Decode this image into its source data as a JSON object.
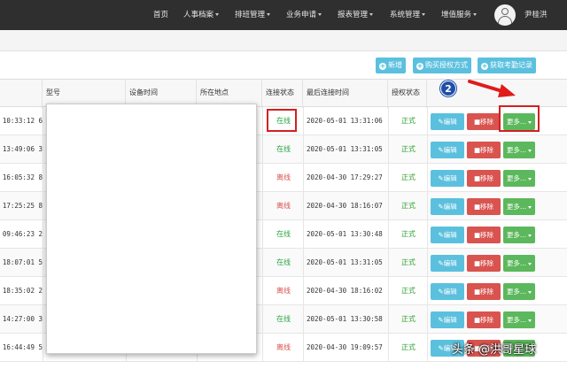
{
  "nav": {
    "items": [
      {
        "label": "首页",
        "caret": false
      },
      {
        "label": "人事档案",
        "caret": true
      },
      {
        "label": "排班管理",
        "caret": true
      },
      {
        "label": "业务申请",
        "caret": true
      },
      {
        "label": "报表管理",
        "caret": true
      },
      {
        "label": "系统管理",
        "caret": true
      },
      {
        "label": "增值服务",
        "caret": true
      }
    ],
    "user_name": "尹桂洪",
    "avatar_icon": "user-avatar-icon"
  },
  "toolbar": {
    "add_label": "新增",
    "buy_label": "购买授权方式",
    "fetch_label": "获取考勤记录",
    "button_color": "#5bc0de"
  },
  "table": {
    "headers": {
      "model": "型号",
      "device_time": "设备时间",
      "location": "所在地点",
      "status": "连接状态",
      "last_conn": "最后连接时间",
      "auth": "授权状态"
    },
    "rows": [
      {
        "time": "6 10:33:12",
        "status": "在线",
        "online": true,
        "last": "2020-05-01 13:31:06",
        "auth": "正式"
      },
      {
        "time": "3 13:49:06",
        "status": "在线",
        "online": true,
        "last": "2020-05-01 13:31:05",
        "auth": "正式"
      },
      {
        "time": "8 16:05:32",
        "status": "离线",
        "online": false,
        "last": "2020-04-30 17:29:27",
        "auth": "正式"
      },
      {
        "time": "8 17:25:25",
        "status": "离线",
        "online": false,
        "last": "2020-04-30 18:16:07",
        "auth": "正式"
      },
      {
        "time": "2 09:46:23",
        "status": "在线",
        "online": true,
        "last": "2020-05-01 13:30:48",
        "auth": "正式"
      },
      {
        "time": "5 18:07:01",
        "status": "在线",
        "online": true,
        "last": "2020-05-01 13:31:05",
        "auth": "正式"
      },
      {
        "time": "2 18:35:02",
        "status": "离线",
        "online": false,
        "last": "2020-04-30 18:16:02",
        "auth": "正式"
      },
      {
        "time": "3 14:27:00",
        "status": "在线",
        "online": true,
        "last": "2020-05-01 13:30:58",
        "auth": "正式"
      },
      {
        "time": "5 16:44:49",
        "status": "离线",
        "online": false,
        "last": "2020-04-30 19:09:57",
        "auth": "正式"
      }
    ],
    "edit_label": "编辑",
    "delete_label": "移除",
    "more_label": "更多..."
  },
  "annotation": {
    "badge": "2",
    "highlight_color": "#d42020"
  },
  "watermark": "头条 @洪哥星球"
}
